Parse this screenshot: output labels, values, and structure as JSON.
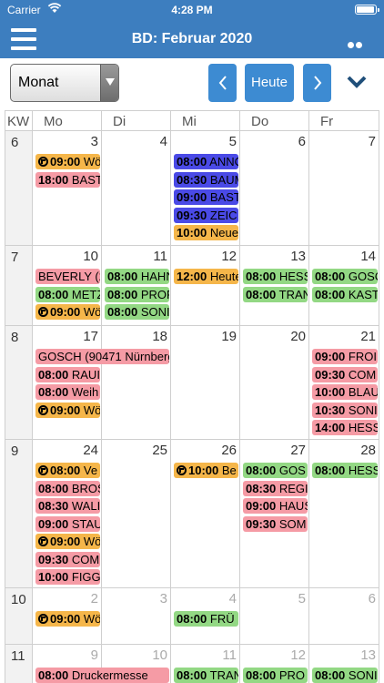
{
  "status": {
    "carrier": "Carrier",
    "time": "4:28 PM"
  },
  "nav": {
    "title": "BD: Februar 2020"
  },
  "toolbar": {
    "view_select": "Monat",
    "today_label": "Heute"
  },
  "headers": [
    "KW",
    "Mo",
    "Di",
    "Mi",
    "Do",
    "Fr"
  ],
  "weeks": [
    {
      "kw": "6",
      "days": [
        {
          "num": "3",
          "events": [
            {
              "time": "09:00",
              "text": "Wö",
              "color": "orange",
              "repeat": true
            },
            {
              "time": "18:00",
              "text": "BAST",
              "color": "pink"
            }
          ]
        },
        {
          "num": "4",
          "events": []
        },
        {
          "num": "5",
          "events": [
            {
              "time": "08:00",
              "text": "ANNO",
              "color": "blue"
            },
            {
              "time": "08:30",
              "text": "BAUM",
              "color": "blue"
            },
            {
              "time": "09:00",
              "text": "BAST",
              "color": "blue"
            },
            {
              "time": "09:30",
              "text": "ZEIC",
              "color": "blue"
            },
            {
              "time": "10:00",
              "text": "Neue",
              "color": "orange"
            }
          ]
        },
        {
          "num": "6",
          "events": []
        },
        {
          "num": "7",
          "events": []
        }
      ]
    },
    {
      "kw": "7",
      "days": [
        {
          "num": "10",
          "events": [
            {
              "time": "",
              "text": "BEVERLY (2",
              "color": "pink"
            },
            {
              "time": "08:00",
              "text": "METZ",
              "color": "green"
            },
            {
              "time": "09:00",
              "text": "Wö",
              "color": "orange",
              "repeat": true
            }
          ]
        },
        {
          "num": "11",
          "events": [
            {
              "time": "08:00",
              "text": "HAHN",
              "color": "green"
            },
            {
              "time": "08:00",
              "text": "PROF",
              "color": "green"
            },
            {
              "time": "08:00",
              "text": "SONI",
              "color": "green"
            }
          ]
        },
        {
          "num": "12",
          "events": [
            {
              "time": "12:00",
              "text": "Heute",
              "color": "orange"
            }
          ]
        },
        {
          "num": "13",
          "events": [
            {
              "time": "08:00",
              "text": "HESS",
              "color": "green"
            },
            {
              "time": "08:00",
              "text": "TRAN",
              "color": "green"
            }
          ]
        },
        {
          "num": "14",
          "events": [
            {
              "time": "08:00",
              "text": "GOSC",
              "color": "green"
            },
            {
              "time": "08:00",
              "text": "KAST",
              "color": "green"
            }
          ]
        }
      ]
    },
    {
      "kw": "8",
      "days": [
        {
          "num": "17",
          "events": [
            {
              "time": "",
              "text": "GOSCH (90471 Nürnberg",
              "color": "pink",
              "span": 2
            },
            {
              "time": "08:00",
              "text": "RAUI",
              "color": "pink"
            },
            {
              "time": "08:00",
              "text": "Weih",
              "color": "pink"
            },
            {
              "time": "09:00",
              "text": "Wö",
              "color": "orange",
              "repeat": true
            }
          ]
        },
        {
          "num": "18",
          "events": []
        },
        {
          "num": "19",
          "events": []
        },
        {
          "num": "20",
          "events": []
        },
        {
          "num": "21",
          "events": [
            {
              "time": "09:00",
              "text": "FROI",
              "color": "pink"
            },
            {
              "time": "09:30",
              "text": "COM",
              "color": "pink"
            },
            {
              "time": "10:00",
              "text": "BLAU",
              "color": "pink"
            },
            {
              "time": "10:30",
              "text": "SONI",
              "color": "pink"
            },
            {
              "time": "14:00",
              "text": "HESS",
              "color": "pink"
            }
          ]
        }
      ]
    },
    {
      "kw": "9",
      "days": [
        {
          "num": "24",
          "events": [
            {
              "time": "08:00",
              "text": "Ve",
              "color": "orange",
              "repeat": true
            },
            {
              "time": "08:00",
              "text": "BROS",
              "color": "pink"
            },
            {
              "time": "08:30",
              "text": "WALI",
              "color": "pink"
            },
            {
              "time": "09:00",
              "text": "STAU",
              "color": "pink"
            },
            {
              "time": "09:00",
              "text": "Wö",
              "color": "orange",
              "repeat": true
            },
            {
              "time": "09:30",
              "text": "COM",
              "color": "pink"
            },
            {
              "time": "10:00",
              "text": "FIGG",
              "color": "pink"
            }
          ]
        },
        {
          "num": "25",
          "events": []
        },
        {
          "num": "26",
          "events": [
            {
              "time": "10:00",
              "text": "Be",
              "color": "orange",
              "repeat": true
            }
          ]
        },
        {
          "num": "27",
          "events": [
            {
              "time": "08:00",
              "text": "GOS",
              "color": "green"
            },
            {
              "time": "08:30",
              "text": "REGI",
              "color": "pink"
            },
            {
              "time": "09:00",
              "text": "HAUS",
              "color": "pink"
            },
            {
              "time": "09:30",
              "text": "SOM",
              "color": "pink"
            }
          ]
        },
        {
          "num": "28",
          "events": [
            {
              "time": "08:00",
              "text": "HESS",
              "color": "green"
            }
          ]
        }
      ]
    },
    {
      "kw": "10",
      "days": [
        {
          "num": "2",
          "other": true,
          "events": [
            {
              "time": "09:00",
              "text": "Wö",
              "color": "orange",
              "repeat": true
            }
          ]
        },
        {
          "num": "3",
          "other": true,
          "events": []
        },
        {
          "num": "4",
          "other": true,
          "events": [
            {
              "time": "08:00",
              "text": "FRÜ",
              "color": "green"
            }
          ]
        },
        {
          "num": "5",
          "other": true,
          "events": []
        },
        {
          "num": "6",
          "other": true,
          "events": []
        }
      ]
    },
    {
      "kw": "11",
      "days": [
        {
          "num": "9",
          "other": true,
          "events": [
            {
              "time": "08:00",
              "text": "Druckermesse",
              "color": "pink",
              "span": 2
            }
          ]
        },
        {
          "num": "10",
          "other": true,
          "events": []
        },
        {
          "num": "11",
          "other": true,
          "events": [
            {
              "time": "08:00",
              "text": "TRAN",
              "color": "green"
            }
          ]
        },
        {
          "num": "12",
          "other": true,
          "events": [
            {
              "time": "08:00",
              "text": "PRO",
              "color": "green"
            }
          ]
        },
        {
          "num": "13",
          "other": true,
          "events": [
            {
              "time": "08:00",
              "text": "SONI",
              "color": "green"
            }
          ]
        }
      ]
    }
  ]
}
